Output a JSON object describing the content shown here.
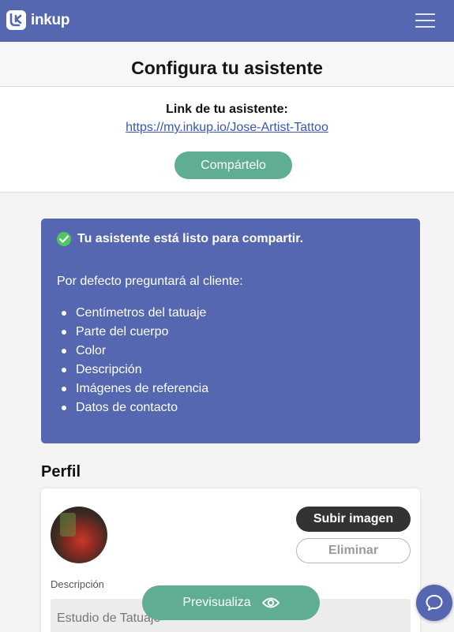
{
  "header": {
    "brand": "inkup",
    "logo_icon": "inkup-logo-icon",
    "menu_icon": "hamburger-menu-icon",
    "brand_color": "#5567b0"
  },
  "page": {
    "title": "Configura tu asistente"
  },
  "share": {
    "label": "Link de tu asistente:",
    "url": "https://my.inkup.io/Jose-Artist-Tattoo",
    "button": "Compártelo",
    "button_color": "#5fae94"
  },
  "status": {
    "ready": "Tu asistente está listo para compartir.",
    "default_text": "Por defecto preguntará al cliente:",
    "questions": [
      "Centímetros del tatuaje",
      "Parte del cuerpo",
      "Color",
      "Descripción",
      "Imágenes de referencia",
      "Datos de contacto"
    ],
    "check_color": "#4ec760"
  },
  "profile": {
    "section_title": "Perfil",
    "upload_button": "Subir imagen",
    "delete_button": "Eliminar",
    "description_label": "Descripción",
    "description_value": "Estudio de Tatuaje"
  },
  "floating": {
    "preview_button": "Previsualiza",
    "preview_icon": "eye-icon",
    "chat_icon": "chat-bubble-icon"
  }
}
